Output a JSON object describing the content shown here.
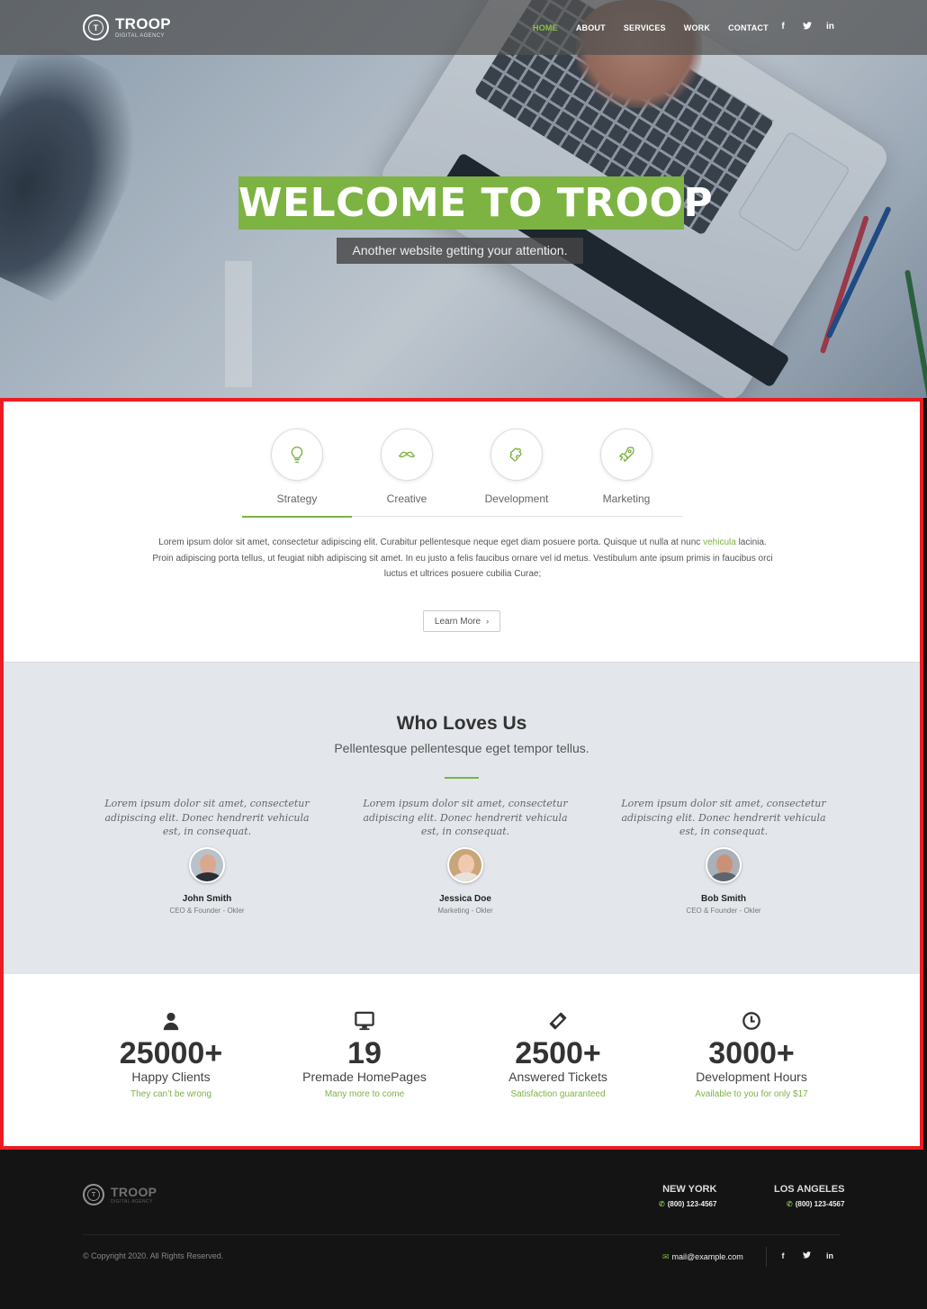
{
  "brand": {
    "name": "TROOP",
    "tagline": "DIGITAL AGENCY",
    "mark": "T"
  },
  "colors": {
    "accent": "#7cb342",
    "frame": "#ec1c24",
    "footer_bg": "#141414",
    "testimonial_bg": "#e3e7ec"
  },
  "nav": {
    "items": [
      {
        "label": "HOME",
        "active": true
      },
      {
        "label": "ABOUT",
        "active": false
      },
      {
        "label": "SERVICES",
        "active": false
      },
      {
        "label": "WORK",
        "active": false
      },
      {
        "label": "CONTACT",
        "active": false
      }
    ],
    "social": [
      {
        "icon": "facebook-icon",
        "glyph": "f"
      },
      {
        "icon": "twitter-icon",
        "glyph": "t"
      },
      {
        "icon": "linkedin-icon",
        "glyph": "in"
      }
    ]
  },
  "hero": {
    "title": "WELCOME TO TROOP",
    "subtitle": "Another website getting your attention."
  },
  "features": {
    "tabs": [
      {
        "label": "Strategy",
        "icon": "lightbulb-icon",
        "active": true
      },
      {
        "label": "Creative",
        "icon": "mustache-icon",
        "active": false
      },
      {
        "label": "Development",
        "icon": "puzzle-icon",
        "active": false
      },
      {
        "label": "Marketing",
        "icon": "rocket-icon",
        "active": false
      }
    ],
    "text_before_link": "Lorem ipsum dolor sit amet, consectetur adipiscing elit. Curabitur pellentesque neque eget diam posuere porta. Quisque ut nulla at nunc",
    "link": "vehicula",
    "text_after_link": "lacinia. Proin adipiscing porta tellus, ut feugiat nibh adipiscing sit amet. In eu justo a felis faucibus ornare vel id metus. Vestibulum ante ipsum primis in faucibus orci luctus et ultrices posuere cubilia Curae;",
    "button_label": "Learn More",
    "button_icon": "chevron-right-icon"
  },
  "testimonials": {
    "title": "Who Loves Us",
    "subtitle": "Pellentesque pellentesque eget tempor tellus.",
    "items": [
      {
        "quote": "Lorem ipsum dolor sit amet, consectetur adipiscing elit. Donec hendrerit vehicula est, in consequat.",
        "name": "John Smith",
        "role": "CEO & Founder - Okler"
      },
      {
        "quote": "Lorem ipsum dolor sit amet, consectetur adipiscing elit. Donec hendrerit vehicula est, in consequat.",
        "name": "Jessica Doe",
        "role": "Marketing - Okler"
      },
      {
        "quote": "Lorem ipsum dolor sit amet, consectetur adipiscing elit. Donec hendrerit vehicula est, in consequat.",
        "name": "Bob Smith",
        "role": "CEO & Founder - Okler"
      }
    ]
  },
  "stats": [
    {
      "icon": "user-icon",
      "value": "25000+",
      "label": "Happy Clients",
      "note": "They can’t be wrong"
    },
    {
      "icon": "desktop-icon",
      "value": "19",
      "label": "Premade HomePages",
      "note": "Many more to come"
    },
    {
      "icon": "ticket-icon",
      "value": "2500+",
      "label": "Answered Tickets",
      "note": "Satisfaction guaranteed"
    },
    {
      "icon": "clock-icon",
      "value": "3000+",
      "label": "Development Hours",
      "note": "Available to you for only $17"
    }
  ],
  "footer": {
    "offices": [
      {
        "city": "NEW YORK",
        "phone": "(800) 123-4567"
      },
      {
        "city": "LOS ANGELES",
        "phone": "(800) 123-4567"
      }
    ],
    "copyright": "© Copyright 2020. All Rights Reserved.",
    "email": "mail@example.com"
  }
}
